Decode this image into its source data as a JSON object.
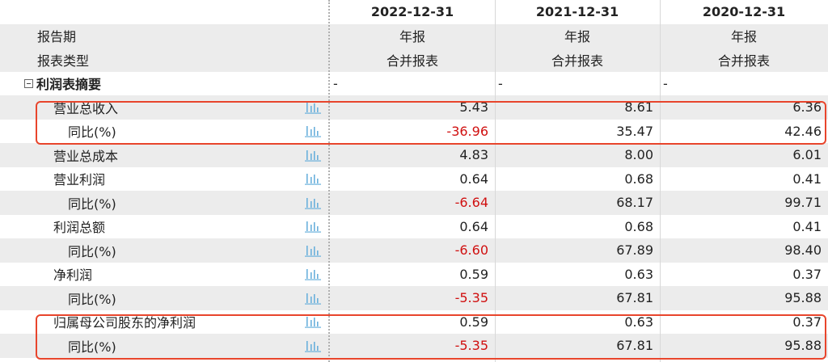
{
  "columns": [
    "2022-12-31",
    "2021-12-31",
    "2020-12-31"
  ],
  "header_rows": [
    {
      "label": "报告期",
      "values": [
        "年报",
        "年报",
        "年报"
      ]
    },
    {
      "label": "报表类型",
      "values": [
        "合并报表",
        "合并报表",
        "合并报表"
      ]
    }
  ],
  "section": {
    "label": "利润表摘要",
    "values": [
      "-",
      "-",
      "-"
    ]
  },
  "rows": [
    {
      "label": "营业总收入",
      "values": [
        "5.43",
        "8.61",
        "6.36"
      ]
    },
    {
      "label": "同比(%)",
      "values": [
        "-36.96",
        "35.47",
        "42.46"
      ]
    },
    {
      "label": "营业总成本",
      "values": [
        "4.83",
        "8.00",
        "6.01"
      ]
    },
    {
      "label": "营业利润",
      "values": [
        "0.64",
        "0.68",
        "0.41"
      ]
    },
    {
      "label": "同比(%)",
      "values": [
        "-6.64",
        "68.17",
        "99.71"
      ]
    },
    {
      "label": "利润总额",
      "values": [
        "0.64",
        "0.68",
        "0.41"
      ]
    },
    {
      "label": "同比(%)",
      "values": [
        "-6.60",
        "67.89",
        "98.40"
      ]
    },
    {
      "label": "净利润",
      "values": [
        "0.59",
        "0.63",
        "0.37"
      ]
    },
    {
      "label": "同比(%)",
      "values": [
        "-5.35",
        "67.81",
        "95.88"
      ]
    },
    {
      "label": "归属母公司股东的净利润",
      "values": [
        "0.59",
        "0.63",
        "0.37"
      ]
    },
    {
      "label": "同比(%)",
      "values": [
        "-5.35",
        "67.81",
        "95.88"
      ]
    }
  ],
  "colors": {
    "negative": "#d01010",
    "highlight": "#e8452c",
    "chart_icon": "#6ab0dc",
    "shade": "#ececec"
  },
  "icons": {
    "row_chart": "bar-chart-icon",
    "section": "collapse-minus-icon"
  }
}
